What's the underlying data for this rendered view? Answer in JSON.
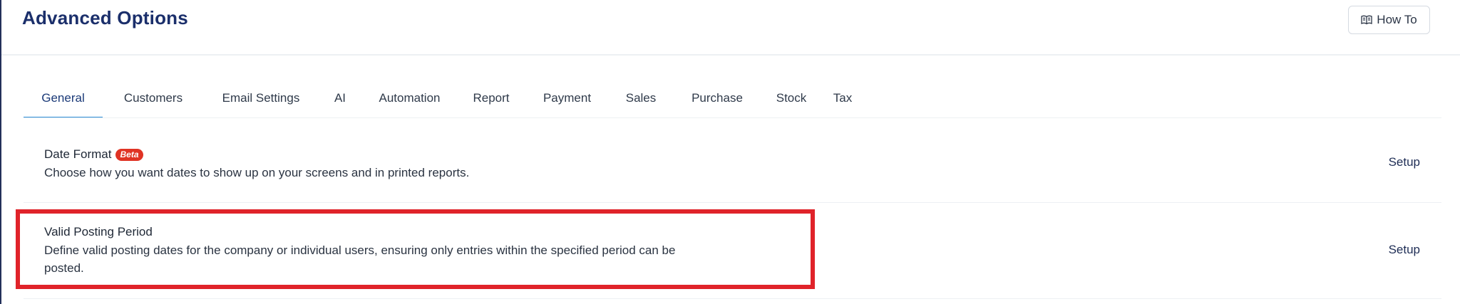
{
  "header": {
    "title": "Advanced Options",
    "how_to_label": "How To",
    "how_to_icon": "book-icon"
  },
  "tabs": [
    {
      "label": "General",
      "active": true
    },
    {
      "label": "Customers",
      "active": false
    },
    {
      "label": "Email Settings",
      "active": false
    },
    {
      "label": "AI",
      "active": false
    },
    {
      "label": "Automation",
      "active": false
    },
    {
      "label": "Report",
      "active": false
    },
    {
      "label": "Payment",
      "active": false
    },
    {
      "label": "Sales",
      "active": false
    },
    {
      "label": "Purchase",
      "active": false
    },
    {
      "label": "Stock",
      "active": false
    },
    {
      "label": "Tax",
      "active": false
    }
  ],
  "settings": [
    {
      "title": "Date Format",
      "badge": "Beta",
      "description": "Choose how you want dates to show up on your screens and in printed reports.",
      "action": "Setup"
    },
    {
      "title": "Valid Posting Period",
      "description_line1": "Define valid posting dates for the company or individual users, ensuring only entries within the specified period can be",
      "description_line2": "posted.",
      "action": "Setup",
      "highlighted": true
    }
  ],
  "colors": {
    "title": "#1b2f6b",
    "active_tab_underline": "#2b8cd6",
    "beta_badge": "#e03324",
    "highlight_border": "#e0232a"
  }
}
